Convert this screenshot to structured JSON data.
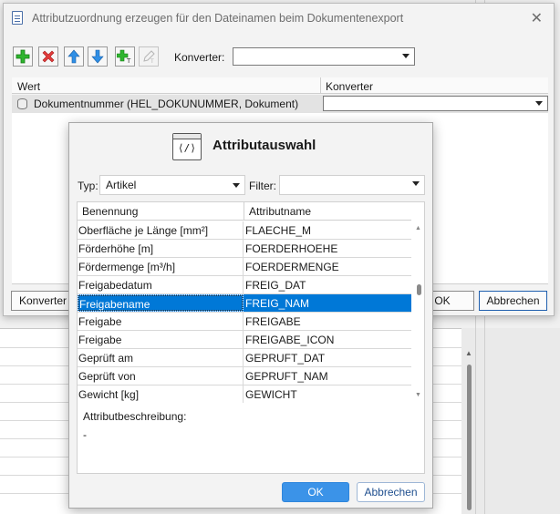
{
  "main_dialog": {
    "title": "Attributzuordnung erzeugen für den Dateinamen beim Dokumentenexport",
    "toolbar": {
      "icons": [
        "add-icon",
        "delete-icon",
        "move-up-icon",
        "move-down-icon",
        "add-attribute-icon",
        "edit-disabled-icon"
      ],
      "converter_label": "Konverter:",
      "converter_value": ""
    },
    "grid": {
      "columns": [
        "Wert",
        "Konverter"
      ],
      "rows": [
        {
          "wert": "Dokumentnummer (HEL_DOKUNUMMER, Dokument)",
          "konverter": ""
        }
      ]
    },
    "buttons": {
      "converter": "Konverter",
      "ok": "OK",
      "cancel": "Abbrechen"
    }
  },
  "popup": {
    "title": "Attributauswahl",
    "icon_text": "⟨/⟩",
    "type_label": "Typ:",
    "type_value": "Artikel",
    "filter_label": "Filter:",
    "filter_value": "",
    "columns": [
      "Benennung",
      "Attributname"
    ],
    "rows": [
      {
        "name": "Oberfläche je Länge [mm²]",
        "attr": "FLAECHE_M",
        "selected": false
      },
      {
        "name": "Förderhöhe [m]",
        "attr": "FOERDERHOEHE",
        "selected": false
      },
      {
        "name": "Fördermenge [m³/h]",
        "attr": "FOERDERMENGE",
        "selected": false
      },
      {
        "name": "Freigabedatum",
        "attr": "FREIG_DAT",
        "selected": false
      },
      {
        "name": "Freigabename",
        "attr": "FREIG_NAM",
        "selected": true
      },
      {
        "name": "Freigabe",
        "attr": "FREIGABE",
        "selected": false
      },
      {
        "name": "Freigabe",
        "attr": "FREIGABE_ICON",
        "selected": false
      },
      {
        "name": "Geprüft am",
        "attr": "GEPRUFT_DAT",
        "selected": false
      },
      {
        "name": "Geprüft von",
        "attr": "GEPRUFT_NAM",
        "selected": false
      },
      {
        "name": "Gewicht [kg]",
        "attr": "GEWICHT",
        "selected": false
      }
    ],
    "description_label": "Attributbeschreibung:",
    "description_value": "-",
    "buttons": {
      "ok": "OK",
      "cancel": "Abbrechen"
    }
  },
  "colors": {
    "selection": "#0078d7",
    "primary_button": "#3b93e8"
  }
}
